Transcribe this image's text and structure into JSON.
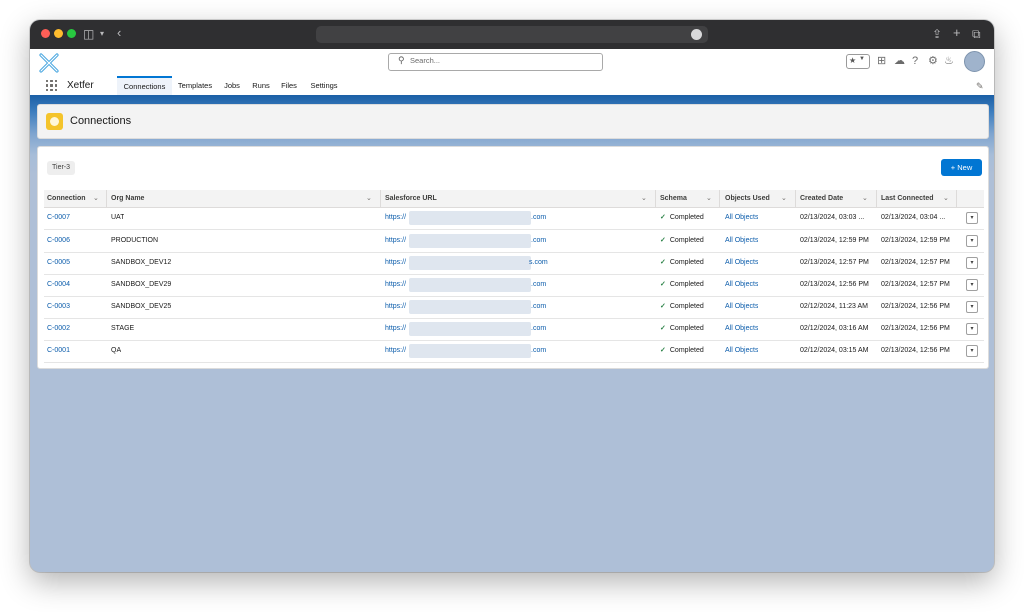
{
  "app": {
    "name": "Xetfer",
    "search_placeholder": "Search...",
    "nav_tabs": [
      {
        "label": "Connections",
        "active": true
      },
      {
        "label": "Templates",
        "active": false
      },
      {
        "label": "Jobs",
        "active": false
      },
      {
        "label": "Runs",
        "active": false
      },
      {
        "label": "Files",
        "active": false
      },
      {
        "label": "Settings",
        "active": false
      }
    ],
    "header_icons": [
      "favorites-star-icon",
      "add-icon",
      "cloud-icon",
      "help-icon",
      "gear-icon",
      "bell-icon",
      "avatar"
    ]
  },
  "page": {
    "title": "Connections",
    "icon_color": "#f4c42b"
  },
  "list": {
    "filter_pill": "Tier-3",
    "new_button": "+ New",
    "columns": [
      "Connection",
      "Org Name",
      "Salesforce URL",
      "Schema",
      "Objects Used",
      "Created Date",
      "Last Connected"
    ],
    "rows": [
      {
        "connection": "C-0007",
        "org": "UAT",
        "url_prefix": "https://",
        "url_suffix": ".com",
        "schema": "Completed",
        "objects": "All Objects",
        "created": "02/13/2024, 03:03 ...",
        "last": "02/13/2024, 03:04 ..."
      },
      {
        "connection": "C-0006",
        "org": "PRODUCTION",
        "url_prefix": "https://",
        "url_suffix": ".com",
        "schema": "Completed",
        "objects": "All Objects",
        "created": "02/13/2024, 12:59 PM",
        "last": "02/13/2024, 12:59 PM"
      },
      {
        "connection": "C-0005",
        "org": "SANDBOX_DEV12",
        "url_prefix": "https://",
        "url_suffix": "s.com",
        "schema": "Completed",
        "objects": "All Objects",
        "created": "02/13/2024, 12:57 PM",
        "last": "02/13/2024, 12:57 PM"
      },
      {
        "connection": "C-0004",
        "org": "SANDBOX_DEV29",
        "url_prefix": "https://",
        "url_suffix": ".com",
        "schema": "Completed",
        "objects": "All Objects",
        "created": "02/13/2024, 12:56 PM",
        "last": "02/13/2024, 12:57 PM"
      },
      {
        "connection": "C-0003",
        "org": "SANDBOX_DEV25",
        "url_prefix": "https://",
        "url_suffix": ".com",
        "schema": "Completed",
        "objects": "All Objects",
        "created": "02/12/2024, 11:23 AM",
        "last": "02/13/2024, 12:56 PM"
      },
      {
        "connection": "C-0002",
        "org": "STAGE",
        "url_prefix": "https://",
        "url_suffix": ".com",
        "schema": "Completed",
        "objects": "All Objects",
        "created": "02/12/2024, 03:16 AM",
        "last": "02/13/2024, 12:56 PM"
      },
      {
        "connection": "C-0001",
        "org": "QA",
        "url_prefix": "https://",
        "url_suffix": ".com",
        "schema": "Completed",
        "objects": "All Objects",
        "created": "02/12/2024, 03:15 AM",
        "last": "02/13/2024, 12:56 PM"
      }
    ]
  }
}
